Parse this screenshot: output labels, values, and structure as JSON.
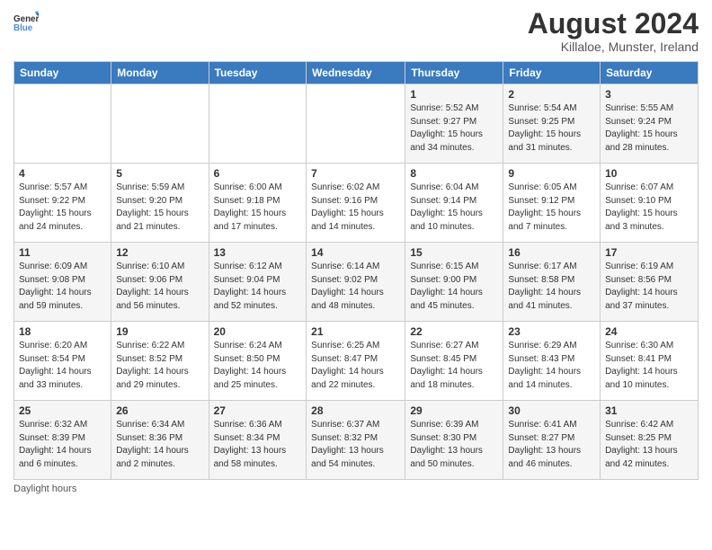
{
  "header": {
    "logo_general": "General",
    "logo_blue": "Blue",
    "month_year": "August 2024",
    "location": "Killaloe, Munster, Ireland"
  },
  "days_of_week": [
    "Sunday",
    "Monday",
    "Tuesday",
    "Wednesday",
    "Thursday",
    "Friday",
    "Saturday"
  ],
  "footer": {
    "note": "Daylight hours"
  },
  "weeks": [
    [
      {
        "day": "",
        "sunrise": "",
        "sunset": "",
        "daylight": "",
        "empty": true
      },
      {
        "day": "",
        "sunrise": "",
        "sunset": "",
        "daylight": "",
        "empty": true
      },
      {
        "day": "",
        "sunrise": "",
        "sunset": "",
        "daylight": "",
        "empty": true
      },
      {
        "day": "",
        "sunrise": "",
        "sunset": "",
        "daylight": "",
        "empty": true
      },
      {
        "day": "1",
        "sunrise": "Sunrise: 5:52 AM",
        "sunset": "Sunset: 9:27 PM",
        "daylight": "Daylight: 15 hours and 34 minutes."
      },
      {
        "day": "2",
        "sunrise": "Sunrise: 5:54 AM",
        "sunset": "Sunset: 9:25 PM",
        "daylight": "Daylight: 15 hours and 31 minutes."
      },
      {
        "day": "3",
        "sunrise": "Sunrise: 5:55 AM",
        "sunset": "Sunset: 9:24 PM",
        "daylight": "Daylight: 15 hours and 28 minutes."
      }
    ],
    [
      {
        "day": "4",
        "sunrise": "Sunrise: 5:57 AM",
        "sunset": "Sunset: 9:22 PM",
        "daylight": "Daylight: 15 hours and 24 minutes."
      },
      {
        "day": "5",
        "sunrise": "Sunrise: 5:59 AM",
        "sunset": "Sunset: 9:20 PM",
        "daylight": "Daylight: 15 hours and 21 minutes."
      },
      {
        "day": "6",
        "sunrise": "Sunrise: 6:00 AM",
        "sunset": "Sunset: 9:18 PM",
        "daylight": "Daylight: 15 hours and 17 minutes."
      },
      {
        "day": "7",
        "sunrise": "Sunrise: 6:02 AM",
        "sunset": "Sunset: 9:16 PM",
        "daylight": "Daylight: 15 hours and 14 minutes."
      },
      {
        "day": "8",
        "sunrise": "Sunrise: 6:04 AM",
        "sunset": "Sunset: 9:14 PM",
        "daylight": "Daylight: 15 hours and 10 minutes."
      },
      {
        "day": "9",
        "sunrise": "Sunrise: 6:05 AM",
        "sunset": "Sunset: 9:12 PM",
        "daylight": "Daylight: 15 hours and 7 minutes."
      },
      {
        "day": "10",
        "sunrise": "Sunrise: 6:07 AM",
        "sunset": "Sunset: 9:10 PM",
        "daylight": "Daylight: 15 hours and 3 minutes."
      }
    ],
    [
      {
        "day": "11",
        "sunrise": "Sunrise: 6:09 AM",
        "sunset": "Sunset: 9:08 PM",
        "daylight": "Daylight: 14 hours and 59 minutes."
      },
      {
        "day": "12",
        "sunrise": "Sunrise: 6:10 AM",
        "sunset": "Sunset: 9:06 PM",
        "daylight": "Daylight: 14 hours and 56 minutes."
      },
      {
        "day": "13",
        "sunrise": "Sunrise: 6:12 AM",
        "sunset": "Sunset: 9:04 PM",
        "daylight": "Daylight: 14 hours and 52 minutes."
      },
      {
        "day": "14",
        "sunrise": "Sunrise: 6:14 AM",
        "sunset": "Sunset: 9:02 PM",
        "daylight": "Daylight: 14 hours and 48 minutes."
      },
      {
        "day": "15",
        "sunrise": "Sunrise: 6:15 AM",
        "sunset": "Sunset: 9:00 PM",
        "daylight": "Daylight: 14 hours and 45 minutes."
      },
      {
        "day": "16",
        "sunrise": "Sunrise: 6:17 AM",
        "sunset": "Sunset: 8:58 PM",
        "daylight": "Daylight: 14 hours and 41 minutes."
      },
      {
        "day": "17",
        "sunrise": "Sunrise: 6:19 AM",
        "sunset": "Sunset: 8:56 PM",
        "daylight": "Daylight: 14 hours and 37 minutes."
      }
    ],
    [
      {
        "day": "18",
        "sunrise": "Sunrise: 6:20 AM",
        "sunset": "Sunset: 8:54 PM",
        "daylight": "Daylight: 14 hours and 33 minutes."
      },
      {
        "day": "19",
        "sunrise": "Sunrise: 6:22 AM",
        "sunset": "Sunset: 8:52 PM",
        "daylight": "Daylight: 14 hours and 29 minutes."
      },
      {
        "day": "20",
        "sunrise": "Sunrise: 6:24 AM",
        "sunset": "Sunset: 8:50 PM",
        "daylight": "Daylight: 14 hours and 25 minutes."
      },
      {
        "day": "21",
        "sunrise": "Sunrise: 6:25 AM",
        "sunset": "Sunset: 8:47 PM",
        "daylight": "Daylight: 14 hours and 22 minutes."
      },
      {
        "day": "22",
        "sunrise": "Sunrise: 6:27 AM",
        "sunset": "Sunset: 8:45 PM",
        "daylight": "Daylight: 14 hours and 18 minutes."
      },
      {
        "day": "23",
        "sunrise": "Sunrise: 6:29 AM",
        "sunset": "Sunset: 8:43 PM",
        "daylight": "Daylight: 14 hours and 14 minutes."
      },
      {
        "day": "24",
        "sunrise": "Sunrise: 6:30 AM",
        "sunset": "Sunset: 8:41 PM",
        "daylight": "Daylight: 14 hours and 10 minutes."
      }
    ],
    [
      {
        "day": "25",
        "sunrise": "Sunrise: 6:32 AM",
        "sunset": "Sunset: 8:39 PM",
        "daylight": "Daylight: 14 hours and 6 minutes."
      },
      {
        "day": "26",
        "sunrise": "Sunrise: 6:34 AM",
        "sunset": "Sunset: 8:36 PM",
        "daylight": "Daylight: 14 hours and 2 minutes."
      },
      {
        "day": "27",
        "sunrise": "Sunrise: 6:36 AM",
        "sunset": "Sunset: 8:34 PM",
        "daylight": "Daylight: 13 hours and 58 minutes."
      },
      {
        "day": "28",
        "sunrise": "Sunrise: 6:37 AM",
        "sunset": "Sunset: 8:32 PM",
        "daylight": "Daylight: 13 hours and 54 minutes."
      },
      {
        "day": "29",
        "sunrise": "Sunrise: 6:39 AM",
        "sunset": "Sunset: 8:30 PM",
        "daylight": "Daylight: 13 hours and 50 minutes."
      },
      {
        "day": "30",
        "sunrise": "Sunrise: 6:41 AM",
        "sunset": "Sunset: 8:27 PM",
        "daylight": "Daylight: 13 hours and 46 minutes."
      },
      {
        "day": "31",
        "sunrise": "Sunrise: 6:42 AM",
        "sunset": "Sunset: 8:25 PM",
        "daylight": "Daylight: 13 hours and 42 minutes."
      }
    ]
  ]
}
